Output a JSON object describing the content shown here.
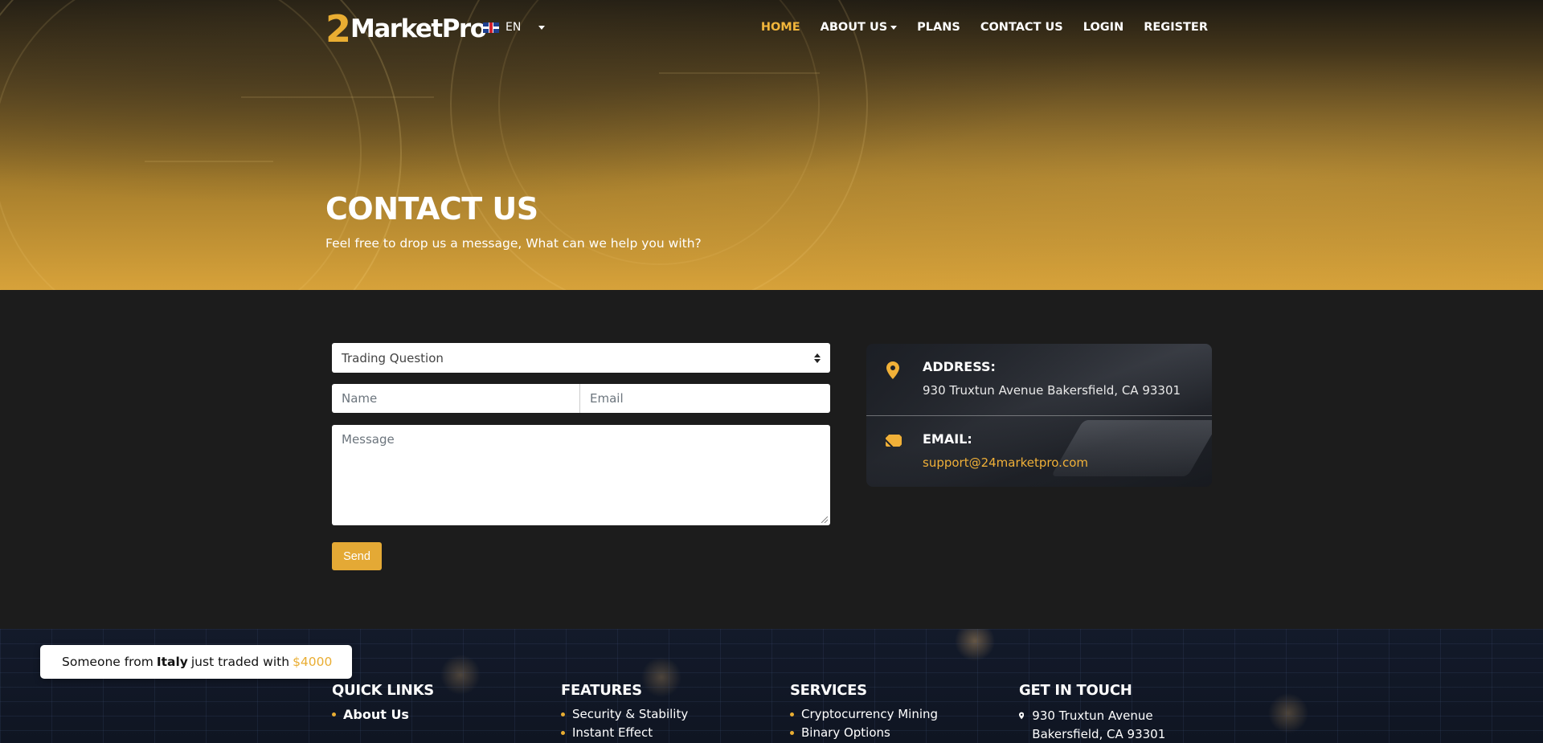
{
  "brand": {
    "logo_number": "2",
    "logo_text": "MarketPro"
  },
  "language": {
    "code": "EN"
  },
  "nav": {
    "items": [
      {
        "label": "HOME",
        "active": true,
        "has_dropdown": false
      },
      {
        "label": "ABOUT US",
        "active": false,
        "has_dropdown": true
      },
      {
        "label": "PLANS",
        "active": false,
        "has_dropdown": false
      },
      {
        "label": "CONTACT US",
        "active": false,
        "has_dropdown": false
      },
      {
        "label": "LOGIN",
        "active": false,
        "has_dropdown": false
      },
      {
        "label": "REGISTER",
        "active": false,
        "has_dropdown": false
      }
    ]
  },
  "hero": {
    "title": "CONTACT US",
    "subtitle": "Feel free to drop us a message, What can we help you with?"
  },
  "form": {
    "topic_selected": "Trading Question",
    "name_placeholder": "Name",
    "email_placeholder": "Email",
    "message_placeholder": "Message",
    "send_label": "Send"
  },
  "contact_card": {
    "address_label": "ADDRESS:",
    "address_value": "930 Truxtun Avenue Bakersfield, CA 93301",
    "email_label": "EMAIL:",
    "email_value": "support@24marketpro.com"
  },
  "toast": {
    "prefix": "Someone from",
    "country": "Italy",
    "middle": "just traded with",
    "amount": "$4000"
  },
  "footer": {
    "quick_links": {
      "title": "QUICK LINKS",
      "items": [
        "About Us"
      ]
    },
    "features": {
      "title": "FEATURES",
      "items": [
        "Security & Stability",
        "Instant Effect"
      ]
    },
    "services": {
      "title": "SERVICES",
      "items": [
        "Cryptocurrency Mining",
        "Binary Options"
      ]
    },
    "get_in_touch": {
      "title": "GET IN TOUCH",
      "address": "930 Truxtun Avenue Bakersfield, CA 93301"
    }
  },
  "colors": {
    "accent": "#e9ad32",
    "background": "#1c1c1c",
    "footer": "#131a2a"
  }
}
